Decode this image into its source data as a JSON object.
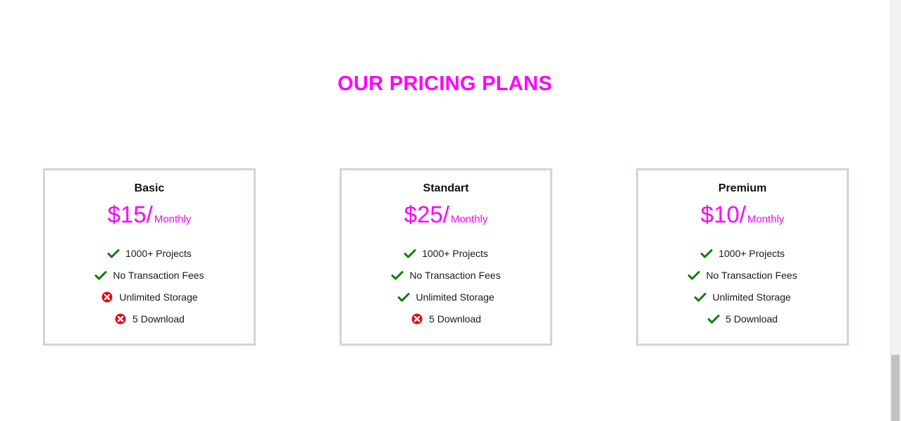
{
  "section": {
    "title": "OUR PRICING PLANS"
  },
  "colors": {
    "accent": "#ff00ff",
    "check": "#0a7a0a",
    "cross": "#e50914",
    "card_border": "#d0d5d6"
  },
  "plans": [
    {
      "name": "Basic",
      "price": "$15/",
      "period": "Monthly",
      "features": [
        {
          "label": "1000+ Projects",
          "included": true,
          "icon": "check-icon"
        },
        {
          "label": "No Transaction Fees",
          "included": true,
          "icon": "check-icon"
        },
        {
          "label": "Unlimited Storage",
          "included": false,
          "icon": "cross-circle-icon"
        },
        {
          "label": "5 Download",
          "included": false,
          "icon": "cross-circle-icon"
        }
      ]
    },
    {
      "name": "Standart",
      "price": "$25/",
      "period": "Monthly",
      "features": [
        {
          "label": "1000+ Projects",
          "included": true,
          "icon": "check-icon"
        },
        {
          "label": "No Transaction Fees",
          "included": true,
          "icon": "check-icon"
        },
        {
          "label": "Unlimited Storage",
          "included": true,
          "icon": "check-icon"
        },
        {
          "label": "5 Download",
          "included": false,
          "icon": "cross-circle-icon"
        }
      ]
    },
    {
      "name": "Premium",
      "price": "$10/",
      "period": "Monthly",
      "features": [
        {
          "label": "1000+ Projects",
          "included": true,
          "icon": "check-icon"
        },
        {
          "label": "No Transaction Fees",
          "included": true,
          "icon": "check-icon"
        },
        {
          "label": "Unlimited Storage",
          "included": true,
          "icon": "check-icon"
        },
        {
          "label": "5 Download",
          "included": true,
          "icon": "check-icon"
        }
      ]
    }
  ]
}
